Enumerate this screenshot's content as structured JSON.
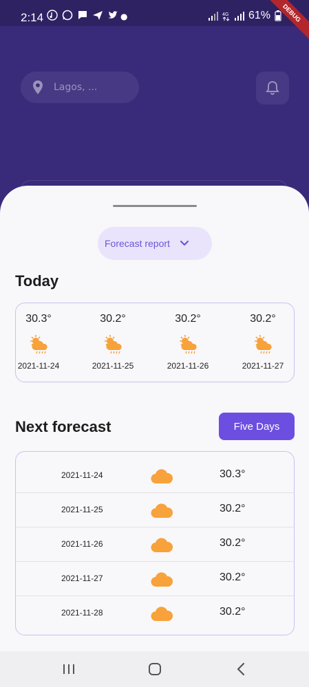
{
  "status_bar": {
    "time": "2:14",
    "battery": "61%",
    "debug_label": "DEBUG"
  },
  "header": {
    "location": "Lagos, ..."
  },
  "sheet": {
    "dropdown_label": "Forecast report",
    "today_title": "Today",
    "today": [
      {
        "temp": "30.3°",
        "date": "2021-11-24",
        "icon": "sun-cloud-rain-icon"
      },
      {
        "temp": "30.2°",
        "date": "2021-11-25",
        "icon": "sun-cloud-rain-icon"
      },
      {
        "temp": "30.2°",
        "date": "2021-11-26",
        "icon": "sun-cloud-rain-icon"
      },
      {
        "temp": "30.2°",
        "date": "2021-11-27",
        "icon": "sun-cloud-rain-icon"
      }
    ],
    "next_title": "Next forecast",
    "five_days_label": "Five Days",
    "forecast": [
      {
        "date": "2021-11-24",
        "temp": "30.3°",
        "icon": "cloud-icon"
      },
      {
        "date": "2021-11-25",
        "temp": "30.2°",
        "icon": "cloud-icon"
      },
      {
        "date": "2021-11-26",
        "temp": "30.2°",
        "icon": "cloud-icon"
      },
      {
        "date": "2021-11-27",
        "temp": "30.2°",
        "icon": "cloud-icon"
      },
      {
        "date": "2021-11-28",
        "temp": "30.2°",
        "icon": "cloud-icon"
      }
    ]
  },
  "colors": {
    "accent": "#6c4ee0",
    "header_bg": "#3a2a7a",
    "icon_orange": "#f7a23a"
  }
}
